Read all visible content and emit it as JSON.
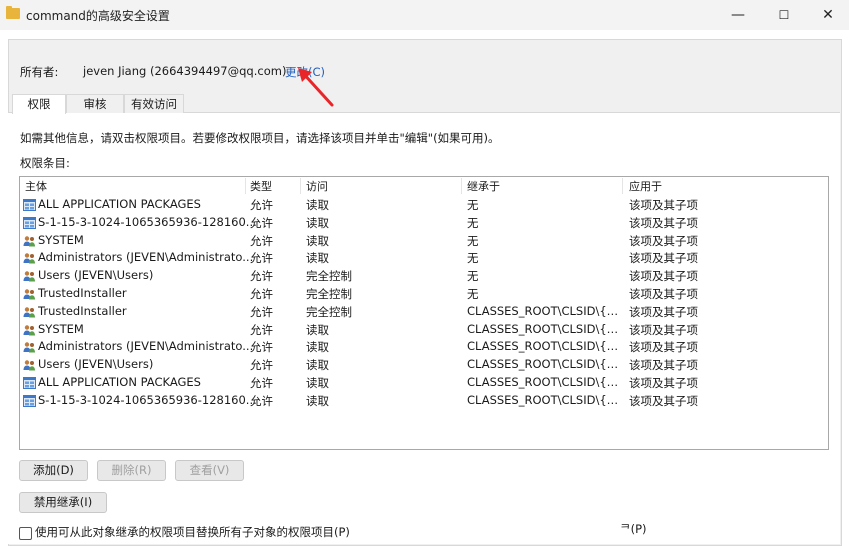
{
  "window": {
    "title": "command的高级安全设置",
    "controls": {
      "minimize": "—",
      "maximize": "☐",
      "close": "✕"
    }
  },
  "owner": {
    "label": "所有者:",
    "value": "jeven Jiang (2664394497@qq.com)",
    "change_link": "更改(C)"
  },
  "tabs": [
    {
      "label": "权限",
      "active": true
    },
    {
      "label": "审核",
      "active": false
    },
    {
      "label": "有效访问",
      "active": false
    }
  ],
  "info_text": "如需其他信息，请双击权限项目。若要修改权限项目，请选择该项目并单击\"编辑\"(如果可用)。",
  "entries_label": "权限条目:",
  "columns": [
    "主体",
    "类型",
    "访问",
    "继承于",
    "应用于"
  ],
  "rows": [
    {
      "icon": "app-packages-icon",
      "principal": "ALL APPLICATION PACKAGES",
      "type": "允许",
      "access": "读取",
      "inherited": "无",
      "applies": "该项及其子项"
    },
    {
      "icon": "app-packages-icon",
      "principal": "S-1-15-3-1024-1065365936-128160...",
      "type": "允许",
      "access": "读取",
      "inherited": "无",
      "applies": "该项及其子项"
    },
    {
      "icon": "users-icon",
      "principal": "SYSTEM",
      "type": "允许",
      "access": "读取",
      "inherited": "无",
      "applies": "该项及其子项"
    },
    {
      "icon": "users-icon",
      "principal": "Administrators (JEVEN\\Administrato...",
      "type": "允许",
      "access": "读取",
      "inherited": "无",
      "applies": "该项及其子项"
    },
    {
      "icon": "users-icon",
      "principal": "Users (JEVEN\\Users)",
      "type": "允许",
      "access": "完全控制",
      "inherited": "无",
      "applies": "该项及其子项"
    },
    {
      "icon": "users-icon",
      "principal": "TrustedInstaller",
      "type": "允许",
      "access": "完全控制",
      "inherited": "无",
      "applies": "该项及其子项"
    },
    {
      "icon": "users-icon",
      "principal": "TrustedInstaller",
      "type": "允许",
      "access": "完全控制",
      "inherited": "CLASSES_ROOT\\CLSID\\{52...",
      "applies": "该项及其子项"
    },
    {
      "icon": "users-icon",
      "principal": "SYSTEM",
      "type": "允许",
      "access": "读取",
      "inherited": "CLASSES_ROOT\\CLSID\\{52...",
      "applies": "该项及其子项"
    },
    {
      "icon": "users-icon",
      "principal": "Administrators (JEVEN\\Administrato...",
      "type": "允许",
      "access": "读取",
      "inherited": "CLASSES_ROOT\\CLSID\\{52...",
      "applies": "该项及其子项"
    },
    {
      "icon": "users-icon",
      "principal": "Users (JEVEN\\Users)",
      "type": "允许",
      "access": "读取",
      "inherited": "CLASSES_ROOT\\CLSID\\{52...",
      "applies": "该项及其子项"
    },
    {
      "icon": "app-packages-icon",
      "principal": "ALL APPLICATION PACKAGES",
      "type": "允许",
      "access": "读取",
      "inherited": "CLASSES_ROOT\\CLSID\\{52...",
      "applies": "该项及其子项"
    },
    {
      "icon": "app-packages-icon",
      "principal": "S-1-15-3-1024-1065365936-128160...",
      "type": "允许",
      "access": "读取",
      "inherited": "CLASSES_ROOT\\CLSID\\{52...",
      "applies": "该项及其子项"
    }
  ],
  "buttons": {
    "add": "添加(D)",
    "remove": "删除(R)",
    "view": "查看(V)",
    "disable_inheritance": "禁用继承(I)"
  },
  "replace_checkbox": {
    "label": "使用可从此对象继承的权限项目替换所有子对象的权限项目(P)",
    "checked": false
  },
  "partial_text": "ᄏ(P)"
}
